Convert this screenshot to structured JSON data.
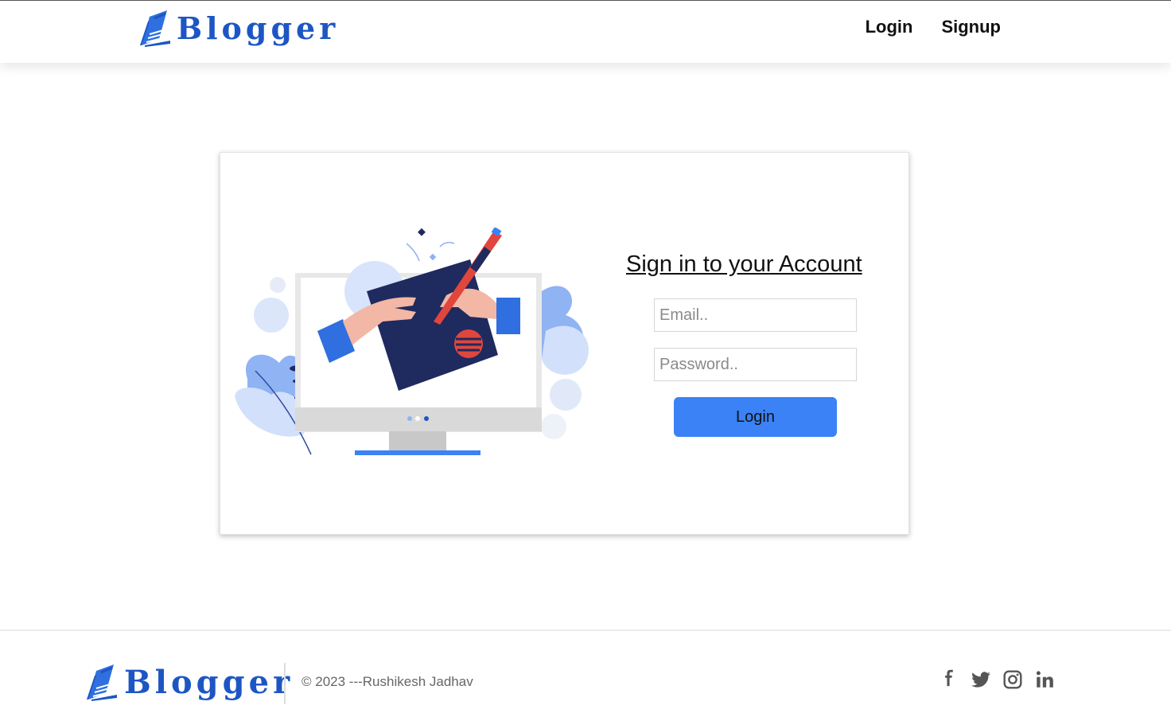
{
  "brand": {
    "name": "Blogger",
    "color": "#1d56c4"
  },
  "navbar": {
    "links": [
      {
        "label": "Login"
      },
      {
        "label": "Signup"
      }
    ]
  },
  "login_form": {
    "title": "Sign in to your Account",
    "email": {
      "value": "",
      "placeholder": "Email.."
    },
    "password": {
      "value": "",
      "placeholder": "Password.."
    },
    "submit_label": "Login",
    "button_color": "#3b82f6"
  },
  "footer": {
    "copyright": "© 2023 ---Rushikesh Jadhav",
    "social_icons": [
      "facebook-icon",
      "twitter-icon",
      "instagram-icon",
      "linkedin-icon"
    ]
  }
}
